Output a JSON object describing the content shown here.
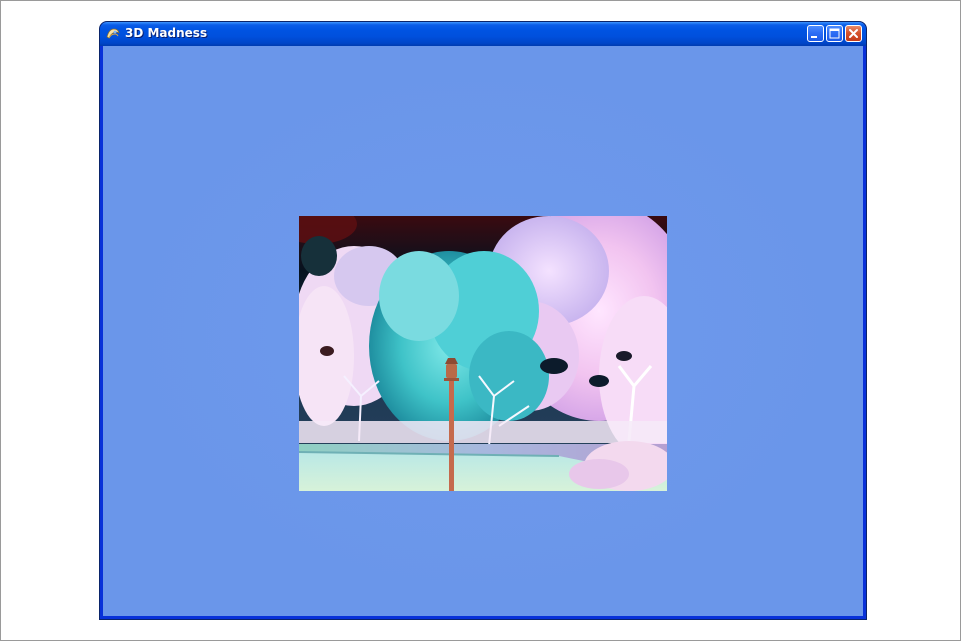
{
  "window": {
    "title": "3D Madness",
    "app_icon": "globe-app-icon",
    "controls": {
      "minimize_icon": "minimize-icon",
      "maximize_icon": "maximize-icon",
      "close_icon": "close-icon"
    }
  },
  "client": {
    "background_color": "#6a96ea"
  },
  "photo": {
    "description_icon": "color-inverted-park-photo",
    "dominant_colors": [
      "#66d3d8",
      "#f2c9f2",
      "#0b1a33",
      "#c56a4c"
    ]
  },
  "colors": {
    "titlebar": "#0054e3",
    "close_button": "#d6532c",
    "page_background": "#ffffff"
  }
}
